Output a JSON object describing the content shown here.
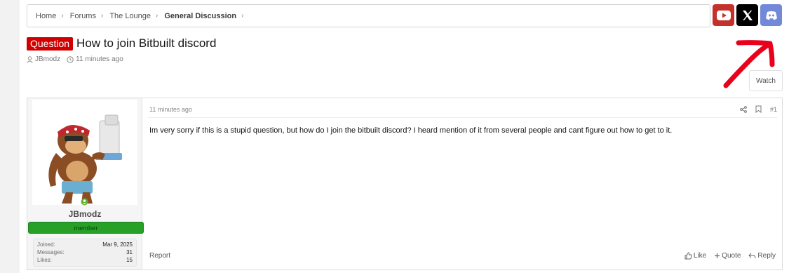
{
  "breadcrumb": [
    "Home",
    "Forums",
    "The Lounge",
    "General Discussion"
  ],
  "thread": {
    "prefix": "Question",
    "title": "How to join Bitbuilt discord",
    "author": "JBmodz",
    "time": "11 minutes ago"
  },
  "watch_label": "Watch",
  "social": [
    "youtube-icon",
    "x-icon",
    "discord-icon"
  ],
  "post": {
    "time": "11 minutes ago",
    "number": "#1",
    "body": "Im very sorry if this is a stupid question, but how do I join the bitbuilt discord? I heard mention of it from several people and cant figure out how to get to it.",
    "report_label": "Report",
    "actions": {
      "like": "Like",
      "quote": "Quote",
      "reply": "Reply"
    }
  },
  "user": {
    "name": "JBmodz",
    "role": "member",
    "stats": [
      {
        "label": "Joined:",
        "value": "Mar 9, 2025"
      },
      {
        "label": "Messages:",
        "value": "31"
      },
      {
        "label": "Likes:",
        "value": "15"
      }
    ]
  },
  "colors": {
    "prefix_bg": "#d10000",
    "role_bg": "#27a027",
    "youtube": "#c4302b",
    "discord": "#7289da",
    "annotation_arrow": "#e8001c"
  }
}
